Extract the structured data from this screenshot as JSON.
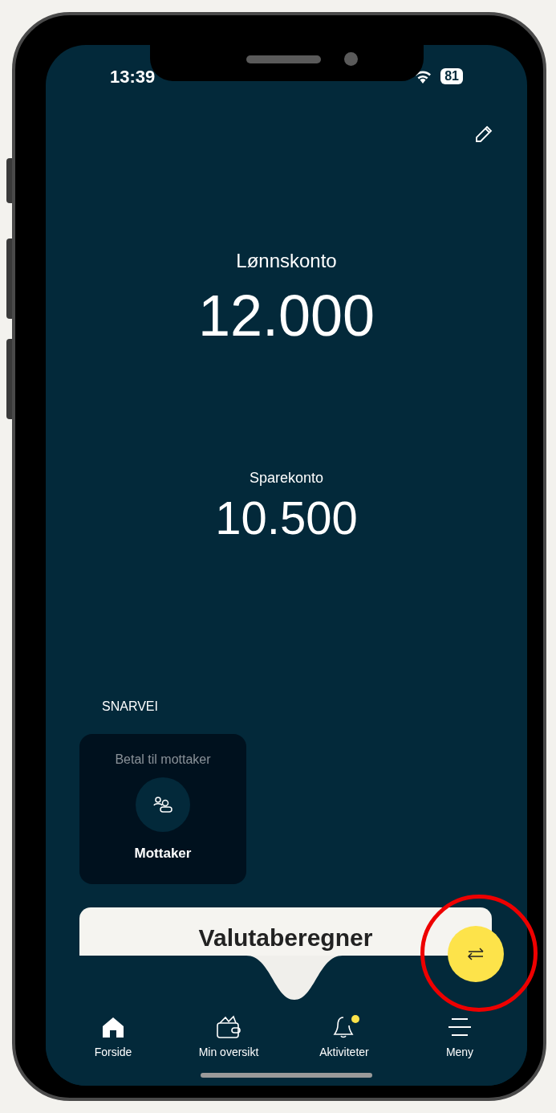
{
  "status_bar": {
    "time": "13:39",
    "battery": "81"
  },
  "accounts": [
    {
      "name": "Lønnskonto",
      "balance": "12.000",
      "kind": "primary"
    },
    {
      "name": "Sparekonto",
      "balance": "10.500",
      "kind": "secondary"
    }
  ],
  "shortcuts": {
    "heading": "SNARVEI",
    "items": [
      {
        "caption": "Betal til mottaker",
        "label": "Mottaker"
      }
    ]
  },
  "card": {
    "title": "Valutaberegner"
  },
  "nav": [
    {
      "label": "Forside",
      "kind": "home",
      "badge": false
    },
    {
      "label": "Min oversikt",
      "kind": "wallet",
      "badge": false
    },
    {
      "label": "Aktiviteter",
      "kind": "bell",
      "badge": true
    },
    {
      "label": "Meny",
      "kind": "menu",
      "badge": false
    }
  ]
}
